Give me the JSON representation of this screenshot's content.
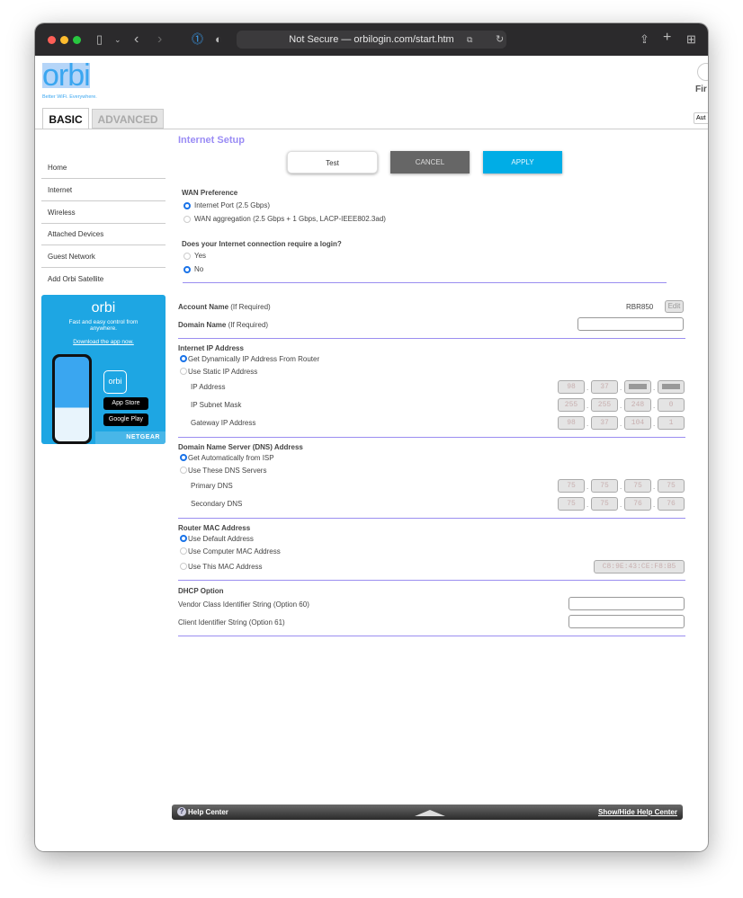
{
  "browser": {
    "url_text": "Not Secure — orbilogin.com/start.htm"
  },
  "header": {
    "logo": "orbi",
    "tagline": "Better WiFi. Everywhere.",
    "right_cut_text": "Fir",
    "right_button_cut": "Aut"
  },
  "tabs": [
    {
      "label": "BASIC"
    },
    {
      "label": "ADVANCED"
    }
  ],
  "sidebar": {
    "items": [
      {
        "label": "Home"
      },
      {
        "label": "Internet"
      },
      {
        "label": "Wireless"
      },
      {
        "label": "Attached Devices"
      },
      {
        "label": "Guest Network"
      },
      {
        "label": "Add Orbi Satellite"
      }
    ]
  },
  "promo": {
    "logo": "orbi",
    "text": "Fast and easy control from anywhere.",
    "link": "Download the app now.",
    "app_store": "App Store",
    "google_play": "Google Play",
    "brand": "NETGEAR"
  },
  "page": {
    "title": "Internet Setup",
    "test": "Test",
    "cancel": "CANCEL",
    "apply": "APPLY"
  },
  "wan": {
    "title": "WAN Preference",
    "opt1": "Internet Port (2.5 Gbps)",
    "opt2": "WAN aggregation (2.5 Gbps + 1 Gbps, LACP-IEEE802.3ad)"
  },
  "login": {
    "question": "Does your Internet connection require a login?",
    "yes": "Yes",
    "no": "No"
  },
  "account": {
    "label": "Account Name",
    "hint": "(If Required)",
    "value": "RBR850",
    "edit": "Edit"
  },
  "domain": {
    "label": "Domain Name",
    "hint": "(If Required)",
    "value": ""
  },
  "ip": {
    "title": "Internet IP Address",
    "opt1": "Get Dynamically IP Address From Router",
    "opt2": "Use Static IP Address",
    "ip_label": "IP Address",
    "ip": [
      "98",
      "37",
      "",
      ""
    ],
    "mask_label": "IP Subnet Mask",
    "mask": [
      "255",
      "255",
      "248",
      "0"
    ],
    "gw_label": "Gateway IP Address",
    "gw": [
      "98",
      "37",
      "104",
      "1"
    ]
  },
  "dns": {
    "title": "Domain Name Server (DNS) Address",
    "opt1": "Get Automatically from ISP",
    "opt2": "Use These DNS Servers",
    "p_label": "Primary DNS",
    "p": [
      "75",
      "75",
      "75",
      "75"
    ],
    "s_label": "Secondary DNS",
    "s": [
      "75",
      "75",
      "76",
      "76"
    ]
  },
  "mac": {
    "title": "Router MAC Address",
    "opt1": "Use Default Address",
    "opt2": "Use Computer MAC Address",
    "opt3": "Use This MAC Address",
    "value": "C8:9E:43:CE:F8:B5"
  },
  "dhcp": {
    "title": "DHCP Option",
    "vendor": "Vendor Class Identifier String (Option 60)",
    "client": "Client Identifier String (Option 61)"
  },
  "help": {
    "title": "Help Center",
    "toggle": "Show/Hide Help Center"
  }
}
